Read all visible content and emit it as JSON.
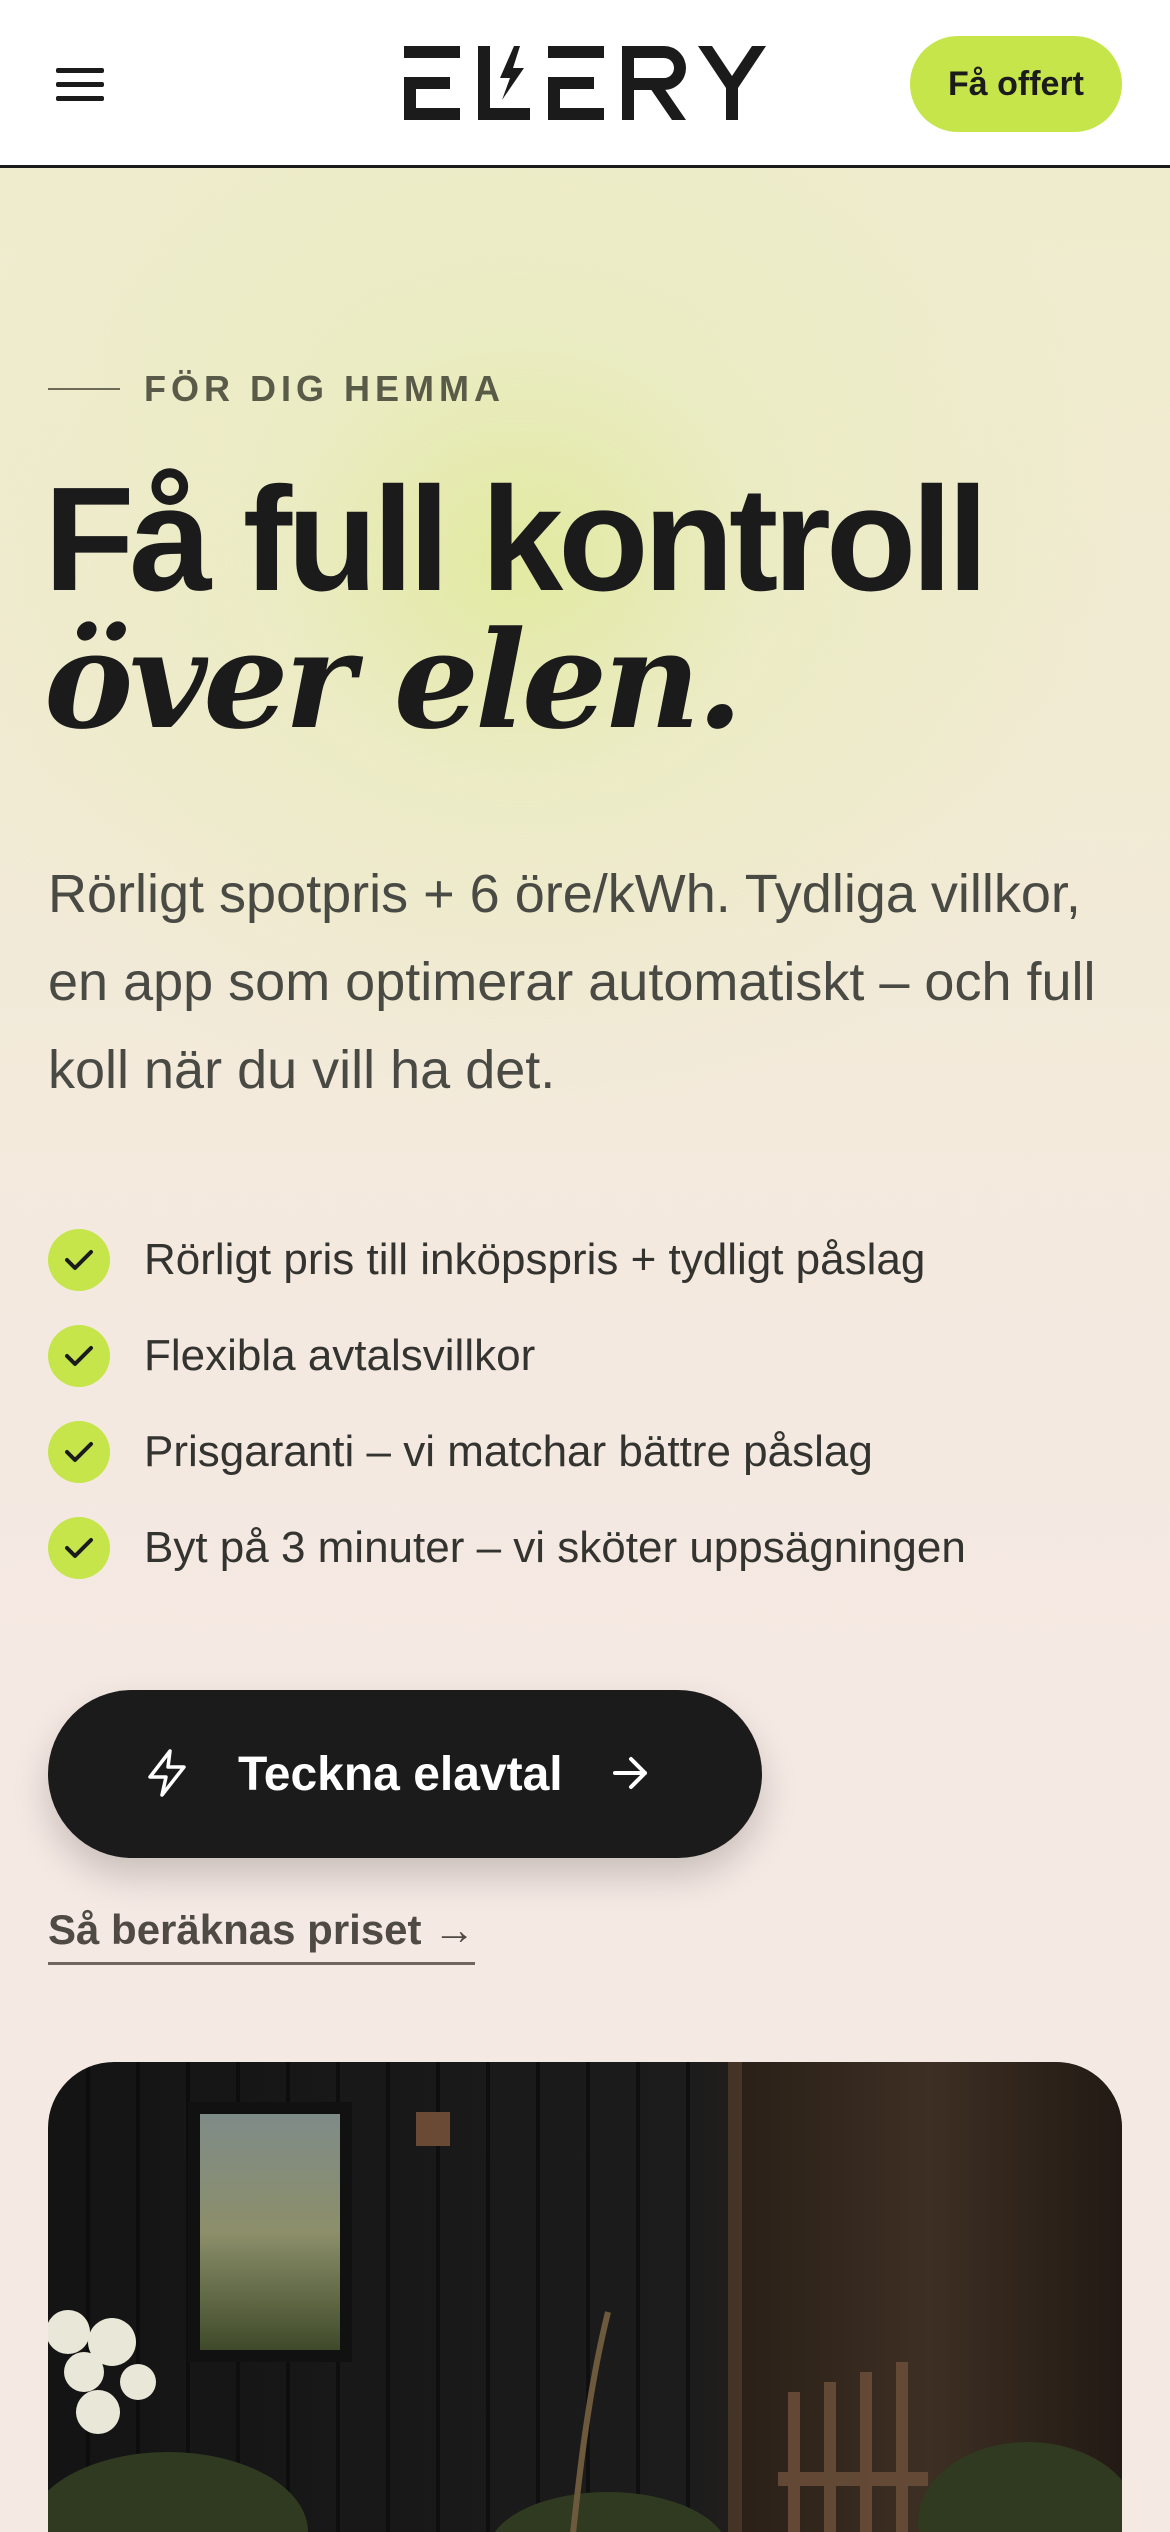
{
  "header": {
    "logo_text": "ELERY",
    "menu_icon": "hamburger-menu-icon",
    "cta_label": "Få offert"
  },
  "hero": {
    "eyebrow": "FÖR DIG HEMMA",
    "title_line1": "Få full kontroll",
    "title_line2": "över elen.",
    "lead": "Rörligt spotpris + 6 öre/kWh. Tydliga villkor, en app som optimerar automatiskt – och full koll när du vill ha det.",
    "features": [
      "Rörligt pris till inköpspris + tydligt påslag",
      "Flexibla avtalsvillkor",
      "Prisgaranti – vi matchar bättre påslag",
      "Byt på 3 minuter – vi sköter uppsägningen"
    ],
    "cta_label": "Teckna elavtal",
    "cta_icon": "lightning-bolt-icon",
    "cta_arrow_icon": "arrow-right-icon",
    "price_link": "Så beräknas priset →"
  },
  "colors": {
    "accent": "#c6e54a",
    "dark": "#1b1b1b",
    "muted_text": "#4a4a44"
  }
}
